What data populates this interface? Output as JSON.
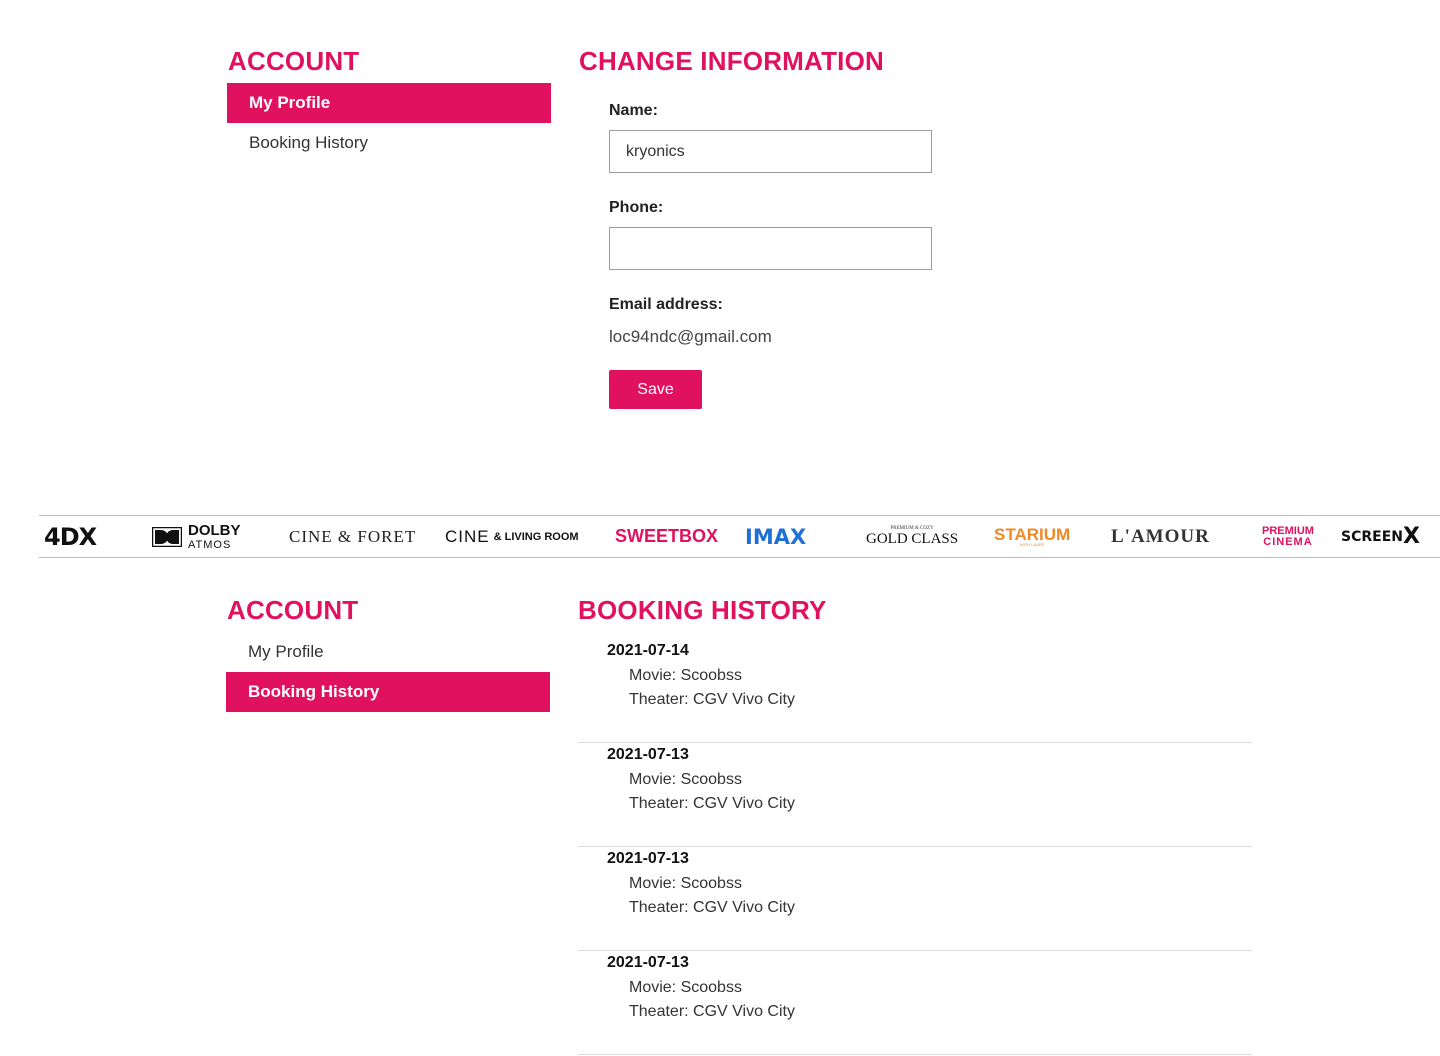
{
  "profile_panel": {
    "account_title": "ACCOUNT",
    "sidebar": [
      {
        "label": "My Profile",
        "active": true
      },
      {
        "label": "Booking History",
        "active": false
      }
    ],
    "form_title": "CHANGE INFORMATION",
    "name_label": "Name:",
    "name_value": "kryonics",
    "phone_label": "Phone:",
    "phone_value": "",
    "email_label": "Email address:",
    "email_value": "loc94ndc@gmail.com",
    "save_label": "Save"
  },
  "format_strip": [
    {
      "name": "4DX",
      "icon": "4dx-logo"
    },
    {
      "name": "DOLBY",
      "sub": "ATMOS",
      "icon": "dolby-atmos-logo"
    },
    {
      "name": "CINE & FORET",
      "icon": "cine-foret-logo"
    },
    {
      "name": "CINE",
      "sub": "& LIVING ROOM",
      "icon": "cine-living-room-logo"
    },
    {
      "name": "SWEETBOX",
      "icon": "sweetbox-logo"
    },
    {
      "name": "IMAX",
      "icon": "imax-logo"
    },
    {
      "name": "GOLD CLASS",
      "sub": "PREMIUM & COZY",
      "icon": "gold-class-logo"
    },
    {
      "name": "STARIUM",
      "sub": "WITH LASER",
      "icon": "starium-logo"
    },
    {
      "name": "L'AMOUR",
      "icon": "lamour-logo"
    },
    {
      "name": "PREMIUM",
      "sub": "CINEMA",
      "icon": "premium-cinema-logo"
    },
    {
      "name": "SCREEN",
      "sub": "X",
      "icon": "screenx-logo"
    }
  ],
  "history_panel": {
    "account_title": "ACCOUNT",
    "sidebar": [
      {
        "label": "My Profile",
        "active": false
      },
      {
        "label": "Booking History",
        "active": true
      }
    ],
    "title": "BOOKING HISTORY",
    "bookings": [
      {
        "date": "2021-07-14",
        "movie": "Movie: Scoobss",
        "theater": "Theater: CGV Vivo City"
      },
      {
        "date": "2021-07-13",
        "movie": "Movie: Scoobss",
        "theater": "Theater: CGV Vivo City"
      },
      {
        "date": "2021-07-13",
        "movie": "Movie: Scoobss",
        "theater": "Theater: CGV Vivo City"
      },
      {
        "date": "2021-07-13",
        "movie": "Movie: Scoobss",
        "theater": "Theater: CGV Vivo City"
      }
    ]
  },
  "colors": {
    "accent": "#e0115f",
    "sweetbox": "#e0115f",
    "imax": "#1f6fd6",
    "starium": "#f08a24",
    "premium": "#e0115f"
  }
}
